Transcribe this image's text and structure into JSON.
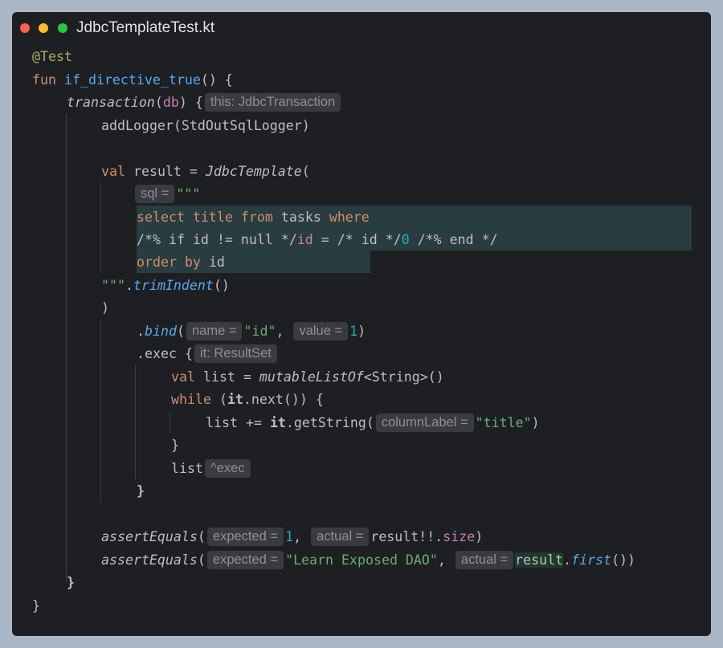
{
  "window": {
    "title": "JdbcTemplateTest.kt"
  },
  "code": {
    "annotation": "@Test",
    "fun_kw": "fun",
    "fun_name": "if_directive_true",
    "fun_tail": "() {",
    "transaction_fn": "transaction",
    "db_open": "(",
    "db_arg": "db",
    "db_close": ") {",
    "hint_this": "this: JdbcTransaction",
    "add_logger": "addLogger(StdOutSqlLogger)",
    "val_kw": "val",
    "result_decl": " result = ",
    "jdbc_template": "JdbcTemplate",
    "open_paren": "(",
    "hint_sql": "sql =",
    "triple_quote": "\"\"\"",
    "sql_select": "select",
    "sql_title": "title",
    "sql_from": "from",
    "sql_tasks": "tasks",
    "sql_where": "where",
    "sql_line2_a": "/*% if id != null */",
    "sql_line2_id": "id",
    "sql_line2_b": " = /* id */",
    "sql_line2_zero": "0",
    "sql_line2_c": " /*% end */",
    "sql_order": "order by",
    "sql_order_id": "id",
    "close_quote": "\"\"\"",
    "trim_dot": ".",
    "trim_indent": "trimIndent",
    "trim_tail": "()",
    "close_paren": ")",
    "bind_dot": ".",
    "bind_fn": "bind",
    "bind_open": "(",
    "hint_name": "name =",
    "bind_name_val": "\"id\"",
    "comma": ",",
    "hint_value": "value =",
    "bind_value": "1",
    "bind_close": ")",
    "exec": ".exec {",
    "hint_it": "it: ResultSet",
    "list_decl": " list = ",
    "mutable_list": "mutableListOf",
    "list_type": "<String>()",
    "while_kw": "while",
    "while_open": " (",
    "it_kw": "it",
    "while_tail": ".next()) {",
    "list_plus": "list += ",
    "get_string": ".getString(",
    "hint_column": "columnLabel =",
    "column_val": "\"title\"",
    "close_brace": "}",
    "list_ret": "list",
    "hint_exec": "^exec",
    "assert_fn": "assertEquals",
    "assert_open": "(",
    "hint_expected": "expected =",
    "expected_1": "1",
    "hint_actual": "actual =",
    "result_size": "result!!.",
    "size_prop": "size",
    "assert_close": ")",
    "expected_2": "\"Learn Exposed DAO\"",
    "result_var": "result",
    "first_dot": ".",
    "first_fn": "first",
    "first_tail": "())"
  }
}
